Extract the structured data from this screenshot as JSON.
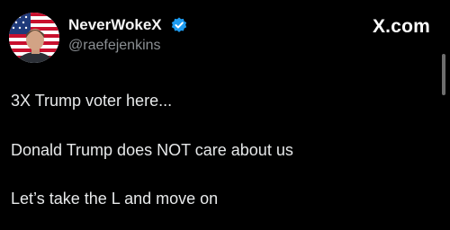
{
  "author": {
    "display_name": "NeverWokeX",
    "handle": "@raefejenkins",
    "verified": true,
    "avatar_icon": "profile-photo"
  },
  "site": {
    "label": "X.com"
  },
  "post": {
    "lines": [
      "3X Trump voter here...",
      "Donald Trump does NOT care about us",
      "Let’s take the L and move on"
    ]
  },
  "colors": {
    "background": "#000000",
    "text": "#e7e9ea",
    "handle": "#8b8f93",
    "verified_badge": "#1d9bf0"
  }
}
